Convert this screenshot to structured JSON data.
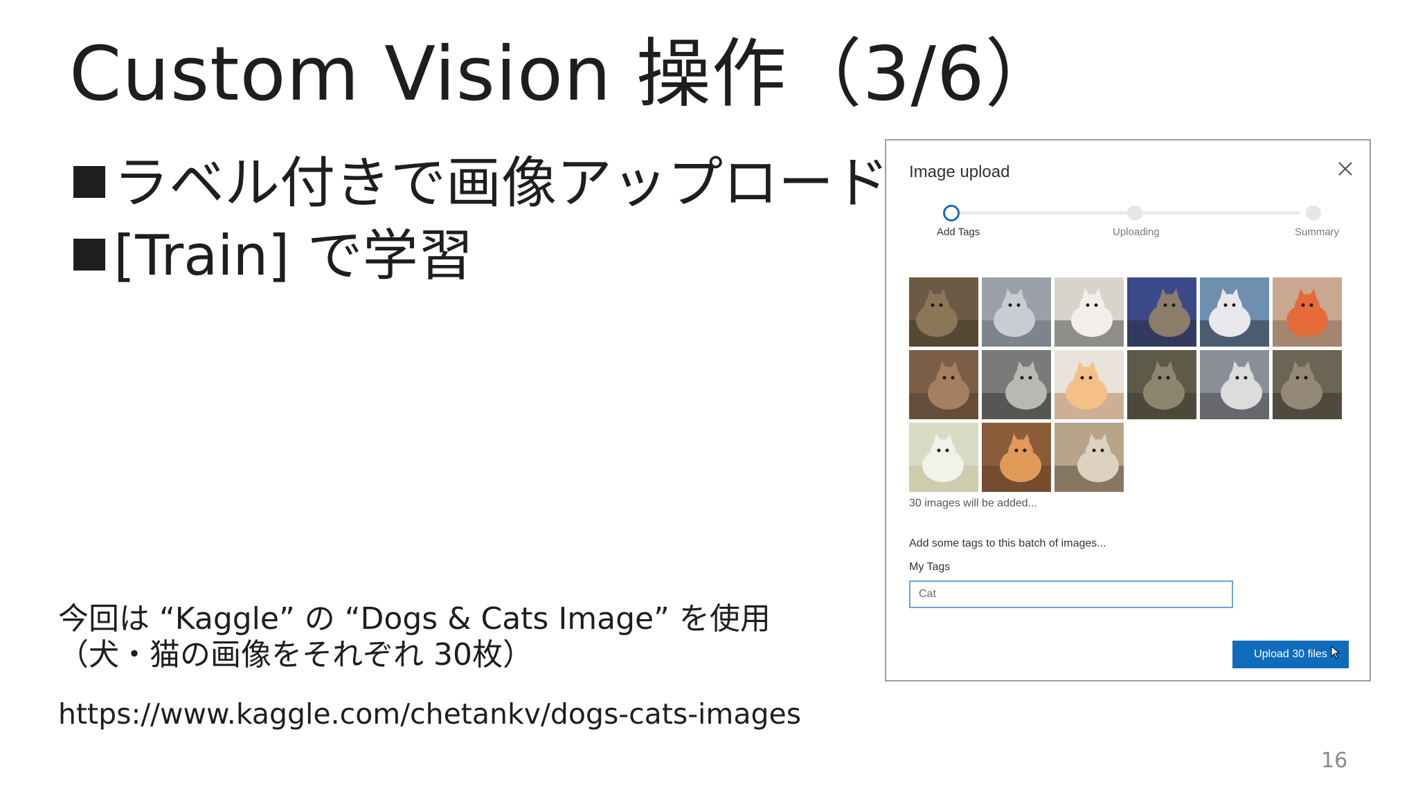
{
  "slide": {
    "title": "Custom Vision 操作（3/6）",
    "bullets": [
      "ラベル付きで画像アップロード",
      "[Train] で学習"
    ],
    "note_line1": "今回は “Kaggle” の “Dogs & Cats Image” を使用",
    "note_line2": "（犬・猫の画像をそれぞれ 30枚）",
    "url": "https://www.kaggle.com/chetankv/dogs-cats-images",
    "page_number": "16"
  },
  "dialog": {
    "title": "Image upload",
    "close_icon": "close-icon",
    "steps": [
      {
        "label": "Add Tags",
        "active": true
      },
      {
        "label": "Uploading",
        "active": false
      },
      {
        "label": "Summary",
        "active": false
      }
    ],
    "thumbnail_count": 15,
    "count_text": "30 images will be added...",
    "tags_heading": "Add some tags to this batch of images...",
    "my_tags_label": "My Tags",
    "tag_input_value": "Cat",
    "upload_button_label": "Upload 30 files",
    "accent_color": "#0f6cbd"
  }
}
